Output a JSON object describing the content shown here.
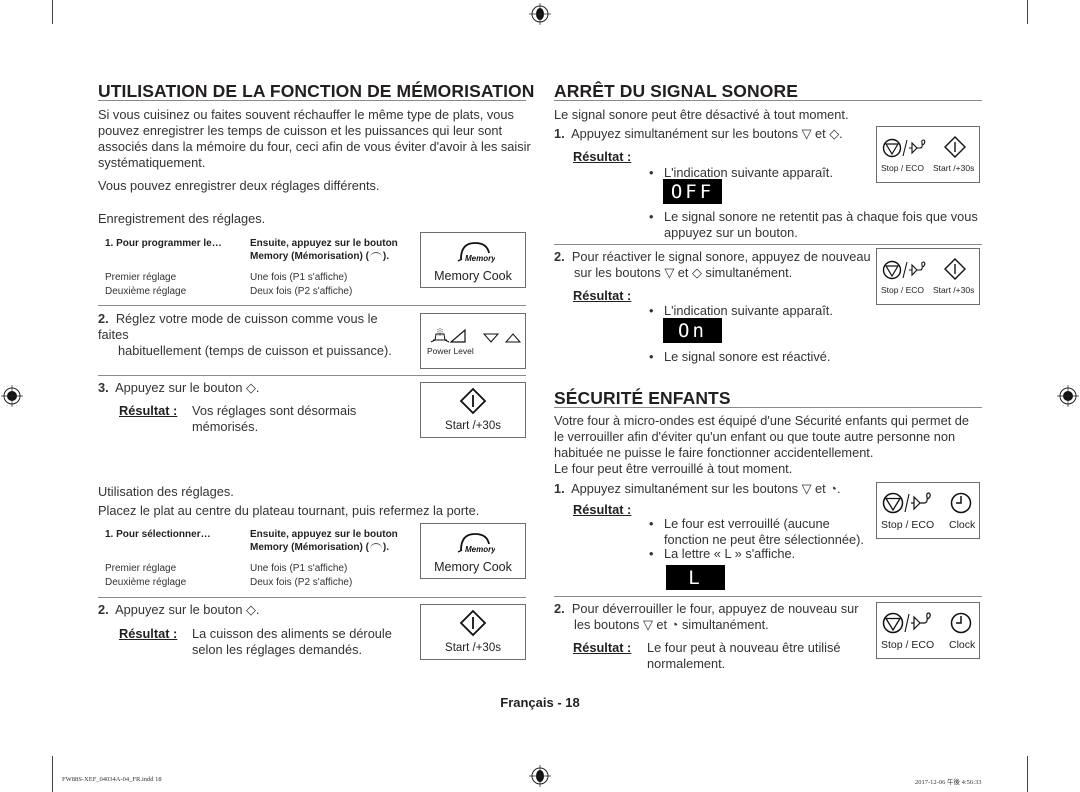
{
  "left": {
    "title": "UTILISATION DE LA FONCTION DE MÉMORISATION",
    "intro": [
      "Si vous cuisinez ou faites souvent réchauffer le même type de plats, vous",
      "pouvez enregistrer les temps de cuisson et les puissances qui leur sont",
      "associés dans la mémoire du four, ceci afin de vous éviter d'avoir à les saisir",
      "systématiquement."
    ],
    "two_settings": "Vous pouvez enregistrer deux réglages différents.",
    "record_heading": "Enregistrement des réglages.",
    "record_table": {
      "col1_header": "1. Pour programmer le…",
      "col2_header_line1": "Ensuite, appuyez sur le bouton",
      "col2_header_line2": "Memory (Mémorisation) (",
      "col2_header_end": ").",
      "rows": [
        {
          "setting": "Premier réglage",
          "action": "Une fois (P1 s'affiche)"
        },
        {
          "setting": "Deuxième réglage",
          "action": "Deux fois (P2 s'affiche)"
        }
      ]
    },
    "memory_button": {
      "icon_text": "Memory",
      "label": "Memory Cook"
    },
    "step2": {
      "num": "2.",
      "line1": "Réglez votre mode de cuisson comme vous le faites",
      "line2": "habituellement (temps de cuisson et puissance)."
    },
    "power_button": {
      "label": "Power Level"
    },
    "step3": {
      "num": "3.",
      "text": "Appuyez sur le bouton",
      "end": ".",
      "result_label": "Résultat :",
      "result_line1": "Vos réglages sont désormais",
      "result_line2": "mémorisés."
    },
    "start_button": {
      "label": "Start /+30s"
    },
    "use_heading": "Utilisation des réglages.",
    "use_instruction": "Placez le plat au centre du plateau tournant, puis refermez la porte.",
    "select_table": {
      "col1_header": "1. Pour sélectionner…",
      "col2_header_line1": "Ensuite, appuyez sur le bouton",
      "col2_header_line2": "Memory (Mémorisation) (",
      "col2_header_end": ").",
      "rows": [
        {
          "setting": "Premier réglage",
          "action": "Une fois (P1 s'affiche)"
        },
        {
          "setting": "Deuxième réglage",
          "action": "Deux fois (P2 s'affiche)"
        }
      ]
    },
    "step2b": {
      "num": "2.",
      "text": "Appuyez sur le bouton",
      "end": ".",
      "result_label": "Résultat :",
      "result_line1": "La cuisson des aliments se déroule",
      "result_line2": "selon les réglages demandés."
    }
  },
  "right": {
    "beep_title": "ARRÊT DU SIGNAL SONORE",
    "beep_intro": "Le signal sonore peut être désactivé à tout moment.",
    "beep_step1": {
      "num": "1.",
      "text": "Appuyez simultanément sur les boutons",
      "and": "et",
      "end": ".",
      "result_label": "Résultat :",
      "bullet1": "L'indication suivante apparaît.",
      "display": "OFF",
      "bullet2_line1": "Le signal sonore ne retentit pas à chaque fois que vous",
      "bullet2_line2": "appuyez sur un bouton."
    },
    "beep_step2": {
      "num": "2.",
      "line1": "Pour réactiver le signal sonore, appuyez de nouveau",
      "line2a": "sur les boutons",
      "and": "et",
      "line2b": "simultanément.",
      "result_label": "Résultat :",
      "bullet1": "L'indication suivante apparaît.",
      "display": "On",
      "bullet2": "Le signal sonore est réactivé."
    },
    "stop_label": "Stop / ECO",
    "start_label": "Start /+30s",
    "clock_label": "Clock",
    "child_title": "SÉCURITÉ ENFANTS",
    "child_intro": [
      "Votre four à micro-ondes est équipé d'une Sécurité enfants qui permet de",
      "le verrouiller afin d'éviter qu'un enfant ou que toute autre personne non",
      "habituée ne puisse le faire fonctionner accidentellement.",
      "Le four peut être verrouillé à tout moment."
    ],
    "child_step1": {
      "num": "1.",
      "text": "Appuyez simultanément sur les boutons",
      "and": "et",
      "end": ".",
      "result_label": "Résultat :",
      "bullet1_line1": "Le four est verrouillé (aucune",
      "bullet1_line2": "fonction ne peut être sélectionnée).",
      "bullet2": "La lettre « L » s'affiche.",
      "display": "L"
    },
    "child_step2": {
      "num": "2.",
      "line1": "Pour déverrouiller le four, appuyez de nouveau sur",
      "line2a": "les boutons",
      "and": "et",
      "line2b": "simultanément.",
      "result_label": "Résultat :",
      "result_line1": "Le four peut à nouveau être utilisé",
      "result_line2": "normalement."
    }
  },
  "page_footer": "Français - 18",
  "print_footer": {
    "file": "FW88S-XEF_04034A-04_FR.indd   18",
    "datetime": "2017-12-06   午後 4:56:33"
  }
}
